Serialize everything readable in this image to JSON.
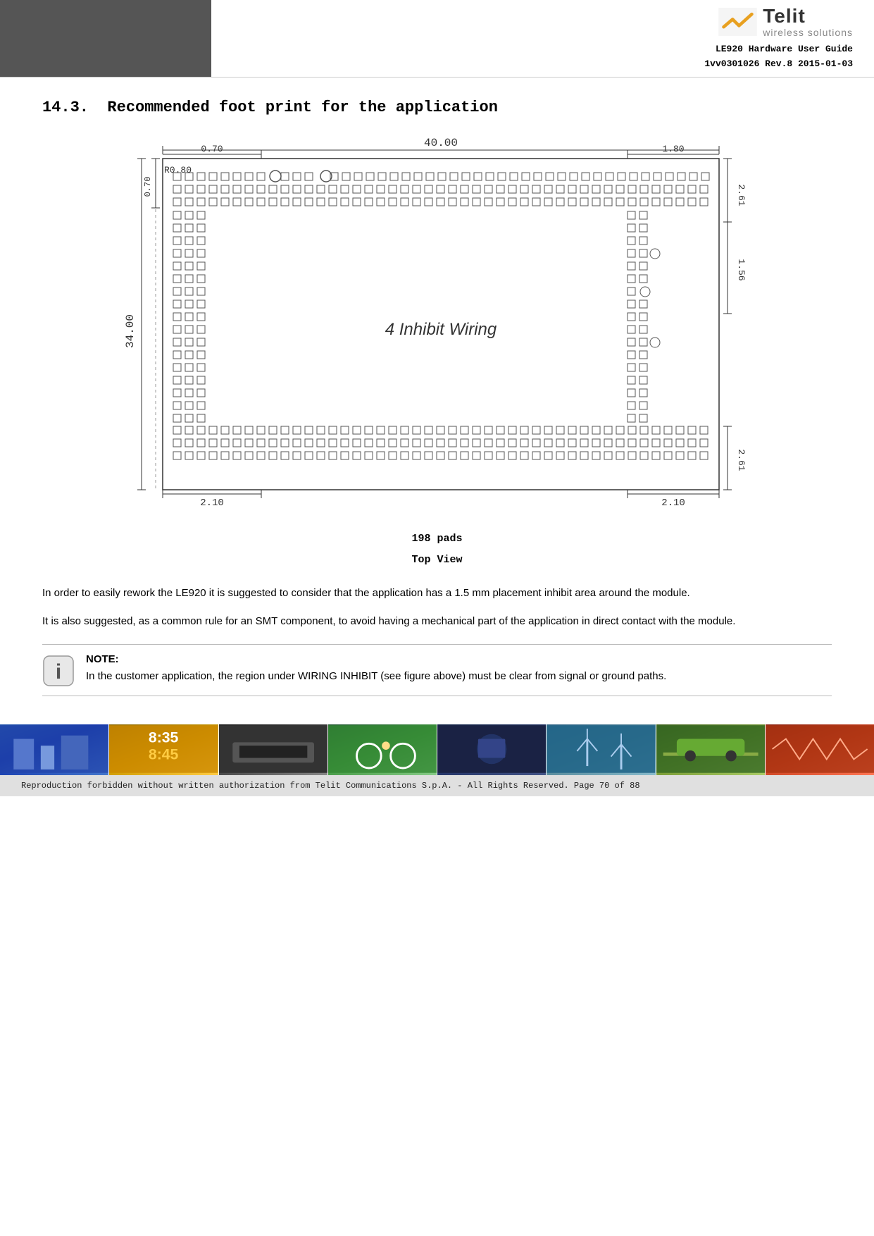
{
  "header": {
    "doc_title_line1": "LE920 Hardware User Guide",
    "doc_title_line2": "1vv0301026 Rev.8    2015-01-03",
    "telit_name": "Telit",
    "telit_subtitle": "wireless solutions"
  },
  "section": {
    "number": "14.3.",
    "title": "Recommended foot print for the application"
  },
  "diagram": {
    "dim_top": "40.00",
    "dim_top_left": "0.70",
    "dim_top_right": "1.80",
    "dim_right_top": "2.61",
    "dim_right_middle": "1.56",
    "dim_right_bottom": "2.61",
    "dim_left": "34.00",
    "dim_left_top": "0.70",
    "dim_corner_tl": "R0.80",
    "dim_bottom_left": "2.10",
    "dim_bottom_right": "2.10",
    "label": "4 Inhibit Wiring",
    "caption1": "198 pads",
    "caption2": "Top View"
  },
  "body_text": {
    "para1": "In order to easily rework the LE920 it is suggested to consider that the application has a 1.5 mm placement inhibit area around the module.",
    "para2": "It is also suggested, as a common rule for an SMT component, to avoid having a mechanical part of the application in direct contact with the module."
  },
  "note": {
    "label": "NOTE:",
    "text": "In the customer application, the region under WIRING INHIBIT (see figure above) must be clear from signal or ground paths."
  },
  "footer": {
    "copyright": "Reproduction forbidden without written authorization from Telit Communications S.p.A. - All Rights Reserved.          Page 70 of 88"
  }
}
